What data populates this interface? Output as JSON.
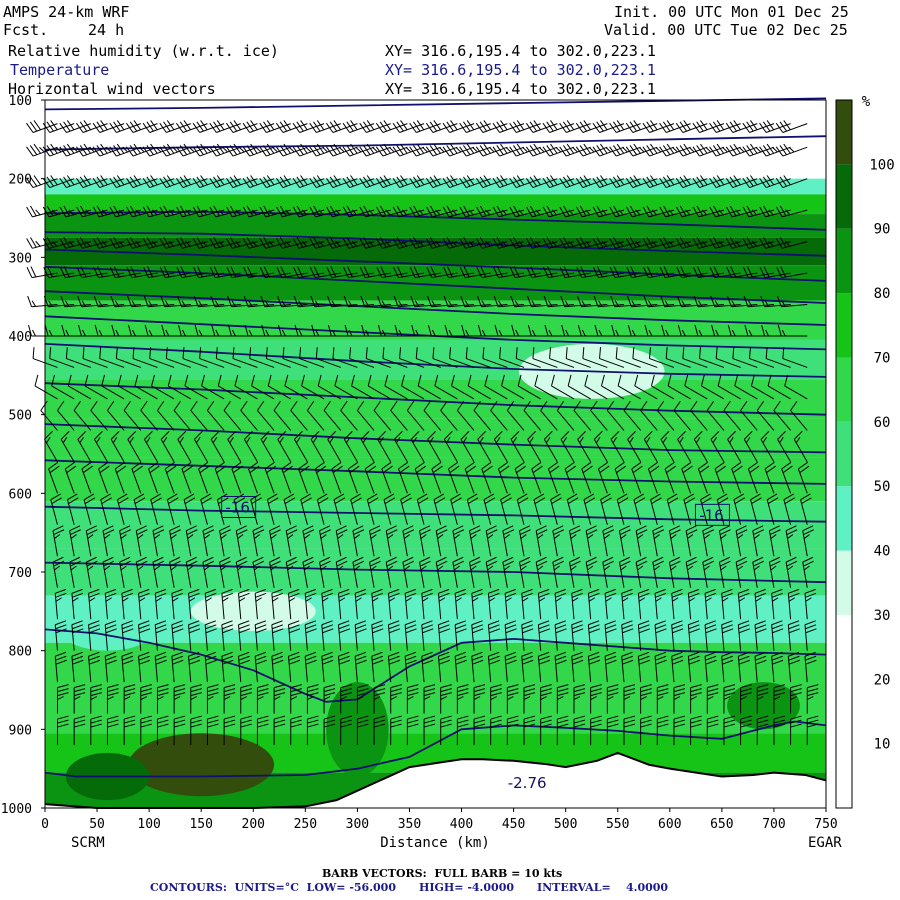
{
  "header": {
    "model": "AMPS 24-km WRF",
    "fcst_label": "Fcst.",
    "fcst_value": "24 h",
    "init": "Init. 00 UTC Mon 01 Dec 25",
    "valid": "Valid. 00 UTC Tue 02 Dec 25",
    "fields": [
      {
        "name": "Relative humidity (w.r.t. ice)",
        "xy": "XY= 316.6,195.4 to 302.0,223.1"
      },
      {
        "name": "Temperature",
        "xy": "XY= 316.6,195.4 to 302.0,223.1"
      },
      {
        "name": "Horizontal wind vectors",
        "xy": "XY= 316.6,195.4 to 302.0,223.1"
      }
    ]
  },
  "footer": {
    "barb_line": "BARB VECTORS:  FULL BARB = 10 kts",
    "contours_line": "CONTOURS:  UNITS=°C  LOW= -56.000      HIGH= -4.0000      INTERVAL=    4.0000"
  },
  "colors": {
    "temperature_contour": "#10106e",
    "rh_scale": [
      "#ffffff",
      "#ffffff",
      "#ffffff",
      "#d2fbe8",
      "#5ff0c4",
      "#3fe07a",
      "#33d84a",
      "#16c418",
      "#0b9412",
      "#056a08",
      "#334d0d"
    ]
  },
  "chart_data": {
    "type": "heatmap",
    "title": "Relative humidity (w.r.t. ice)",
    "xlabel": "Distance (km)",
    "ylabel": "",
    "x_ticks": [
      0,
      50,
      100,
      150,
      200,
      250,
      300,
      350,
      400,
      450,
      500,
      550,
      600,
      650,
      700,
      750
    ],
    "y_ticks": [
      100,
      200,
      300,
      400,
      500,
      600,
      700,
      800,
      900,
      1000
    ],
    "xlim": [
      0,
      750
    ],
    "ylim": [
      1000,
      100
    ],
    "x_endpoints": {
      "left": "SCRM",
      "right": "EGAR"
    },
    "colorbar": {
      "unit": "%",
      "ticks": [
        10,
        20,
        30,
        40,
        50,
        60,
        70,
        80,
        90,
        100
      ],
      "bounds": [
        0,
        10,
        20,
        30,
        40,
        50,
        60,
        70,
        80,
        90,
        100,
        110
      ]
    },
    "rh_layers": [
      {
        "p": 120,
        "rh": 5
      },
      {
        "p": 190,
        "rh": 25
      },
      {
        "p": 210,
        "rh": 45
      },
      {
        "p": 230,
        "rh": 72
      },
      {
        "p": 260,
        "rh": 88
      },
      {
        "p": 290,
        "rh": 92
      },
      {
        "p": 330,
        "rh": 80
      },
      {
        "p": 380,
        "rh": 66
      },
      {
        "p": 430,
        "rh": 55
      },
      {
        "p": 480,
        "rh": 62
      },
      {
        "p": 530,
        "rh": 66
      },
      {
        "p": 580,
        "rh": 64
      },
      {
        "p": 640,
        "rh": 58
      },
      {
        "p": 700,
        "rh": 52
      },
      {
        "p": 760,
        "rh": 48
      },
      {
        "p": 820,
        "rh": 62
      },
      {
        "p": 880,
        "rh": 68
      },
      {
        "p": 930,
        "rh": 75
      },
      {
        "p": 980,
        "rh": 82
      }
    ],
    "rh_features": [
      {
        "x": 525,
        "p": 445,
        "rx": 70,
        "rp": 35,
        "rh": 35
      },
      {
        "x": 200,
        "p": 750,
        "rx": 60,
        "rp": 25,
        "rh": 32
      },
      {
        "x": 60,
        "p": 780,
        "rx": 40,
        "rp": 20,
        "rh": 40
      },
      {
        "x": 150,
        "p": 945,
        "rx": 70,
        "rp": 40,
        "rh": 102
      },
      {
        "x": 60,
        "p": 960,
        "rx": 40,
        "rp": 30,
        "rh": 92
      },
      {
        "x": 690,
        "p": 870,
        "rx": 35,
        "rp": 30,
        "rh": 85
      },
      {
        "x": 300,
        "p": 900,
        "rx": 30,
        "rp": 60,
        "rh": 80
      }
    ],
    "temperature_contours": [
      {
        "x": [
          0,
          150,
          300,
          450,
          600,
          750
        ],
        "p": [
          112,
          110,
          107,
          104,
          101,
          98
        ]
      },
      {
        "x": [
          0,
          150,
          300,
          450,
          600,
          750
        ],
        "p": [
          163,
          160,
          158,
          154,
          150,
          146
        ]
      },
      {
        "x": [
          0,
          150,
          300,
          450,
          600,
          750
        ],
        "p": [
          244,
          242,
          246,
          252,
          258,
          265
        ]
      },
      {
        "x": [
          0,
          150,
          300,
          450,
          600,
          750
        ],
        "p": [
          268,
          270,
          276,
          285,
          292,
          298
        ]
      },
      {
        "x": [
          0,
          150,
          300,
          450,
          600,
          750
        ],
        "p": [
          290,
          297,
          305,
          313,
          322,
          330
        ]
      },
      {
        "x": [
          0,
          150,
          300,
          450,
          600,
          750
        ],
        "p": [
          312,
          320,
          330,
          340,
          350,
          358
        ]
      },
      {
        "x": [
          0,
          150,
          300,
          450,
          600,
          750
        ],
        "p": [
          343,
          352,
          362,
          372,
          380,
          386
        ]
      },
      {
        "x": [
          0,
          150,
          300,
          450,
          600,
          750
        ],
        "p": [
          375,
          385,
          395,
          405,
          412,
          417
        ]
      },
      {
        "x": [
          0,
          150,
          300,
          450,
          600,
          750
        ],
        "p": [
          410,
          420,
          432,
          442,
          448,
          452
        ]
      },
      {
        "x": [
          0,
          150,
          300,
          450,
          600,
          750
        ],
        "p": [
          460,
          468,
          478,
          488,
          495,
          500
        ]
      },
      {
        "x": [
          0,
          150,
          300,
          450,
          600,
          750
        ],
        "p": [
          512,
          520,
          530,
          538,
          545,
          548
        ]
      },
      {
        "x": [
          0,
          150,
          300,
          450,
          600,
          750
        ],
        "p": [
          558,
          565,
          572,
          580,
          585,
          588
        ]
      },
      {
        "x": [
          0,
          150,
          300,
          450,
          600,
          750
        ],
        "p": [
          617,
          622,
          625,
          628,
          633,
          636
        ]
      },
      {
        "x": [
          0,
          150,
          300,
          450,
          600,
          750
        ],
        "p": [
          688,
          692,
          697,
          700,
          708,
          713
        ]
      },
      {
        "x": [
          0,
          50,
          100,
          150,
          200,
          250,
          270,
          300,
          350,
          400,
          450,
          500,
          550,
          600,
          650,
          700,
          750
        ],
        "p": [
          773,
          778,
          790,
          805,
          825,
          855,
          865,
          862,
          820,
          790,
          785,
          790,
          795,
          800,
          802,
          803,
          805
        ]
      },
      {
        "x": [
          0,
          30,
          80,
          150,
          250,
          300,
          350,
          400,
          450,
          500,
          550,
          600,
          650,
          700,
          720,
          750
        ],
        "p": [
          955,
          960,
          960,
          960,
          958,
          950,
          935,
          900,
          895,
          898,
          902,
          908,
          912,
          895,
          890,
          895
        ]
      }
    ],
    "contour_labels": [
      {
        "x": 185,
        "p": 618,
        "text": "-16"
      },
      {
        "x": 640,
        "p": 628,
        "text": "-16"
      },
      {
        "x": 463,
        "p": 968,
        "text": "-2.76"
      }
    ],
    "terrain": {
      "x": [
        0,
        50,
        100,
        150,
        200,
        250,
        280,
        300,
        330,
        350,
        380,
        400,
        420,
        450,
        480,
        500,
        530,
        550,
        580,
        600,
        630,
        650,
        680,
        700,
        730,
        750
      ],
      "p": [
        995,
        1000,
        1000,
        1000,
        1000,
        998,
        990,
        978,
        960,
        948,
        942,
        938,
        938,
        940,
        944,
        948,
        940,
        930,
        945,
        950,
        956,
        960,
        958,
        955,
        958,
        965
      ]
    },
    "wind_barbs": {
      "x_spacing_km": 16,
      "levels": [
        {
          "p": 130,
          "speed_kts": 30,
          "dir_deg": 250
        },
        {
          "p": 160,
          "speed_kts": 35,
          "dir_deg": 250
        },
        {
          "p": 200,
          "speed_kts": 30,
          "dir_deg": 250
        },
        {
          "p": 240,
          "speed_kts": 25,
          "dir_deg": 255
        },
        {
          "p": 280,
          "speed_kts": 25,
          "dir_deg": 255
        },
        {
          "p": 320,
          "speed_kts": 20,
          "dir_deg": 260
        },
        {
          "p": 360,
          "speed_kts": 15,
          "dir_deg": 265
        },
        {
          "p": 400,
          "speed_kts": 15,
          "dir_deg": 270
        },
        {
          "p": 440,
          "speed_kts": 10,
          "dir_deg": 290
        },
        {
          "p": 480,
          "speed_kts": 10,
          "dir_deg": 300
        },
        {
          "p": 520,
          "speed_kts": 10,
          "dir_deg": 320
        },
        {
          "p": 560,
          "speed_kts": 15,
          "dir_deg": 330
        },
        {
          "p": 600,
          "speed_kts": 20,
          "dir_deg": 340
        },
        {
          "p": 640,
          "speed_kts": 20,
          "dir_deg": 345
        },
        {
          "p": 680,
          "speed_kts": 25,
          "dir_deg": 350
        },
        {
          "p": 720,
          "speed_kts": 25,
          "dir_deg": 350
        },
        {
          "p": 760,
          "speed_kts": 25,
          "dir_deg": 355
        },
        {
          "p": 800,
          "speed_kts": 30,
          "dir_deg": 355
        },
        {
          "p": 840,
          "speed_kts": 30,
          "dir_deg": 355
        },
        {
          "p": 880,
          "speed_kts": 35,
          "dir_deg": 0
        },
        {
          "p": 920,
          "speed_kts": 30,
          "dir_deg": 0
        }
      ]
    }
  }
}
